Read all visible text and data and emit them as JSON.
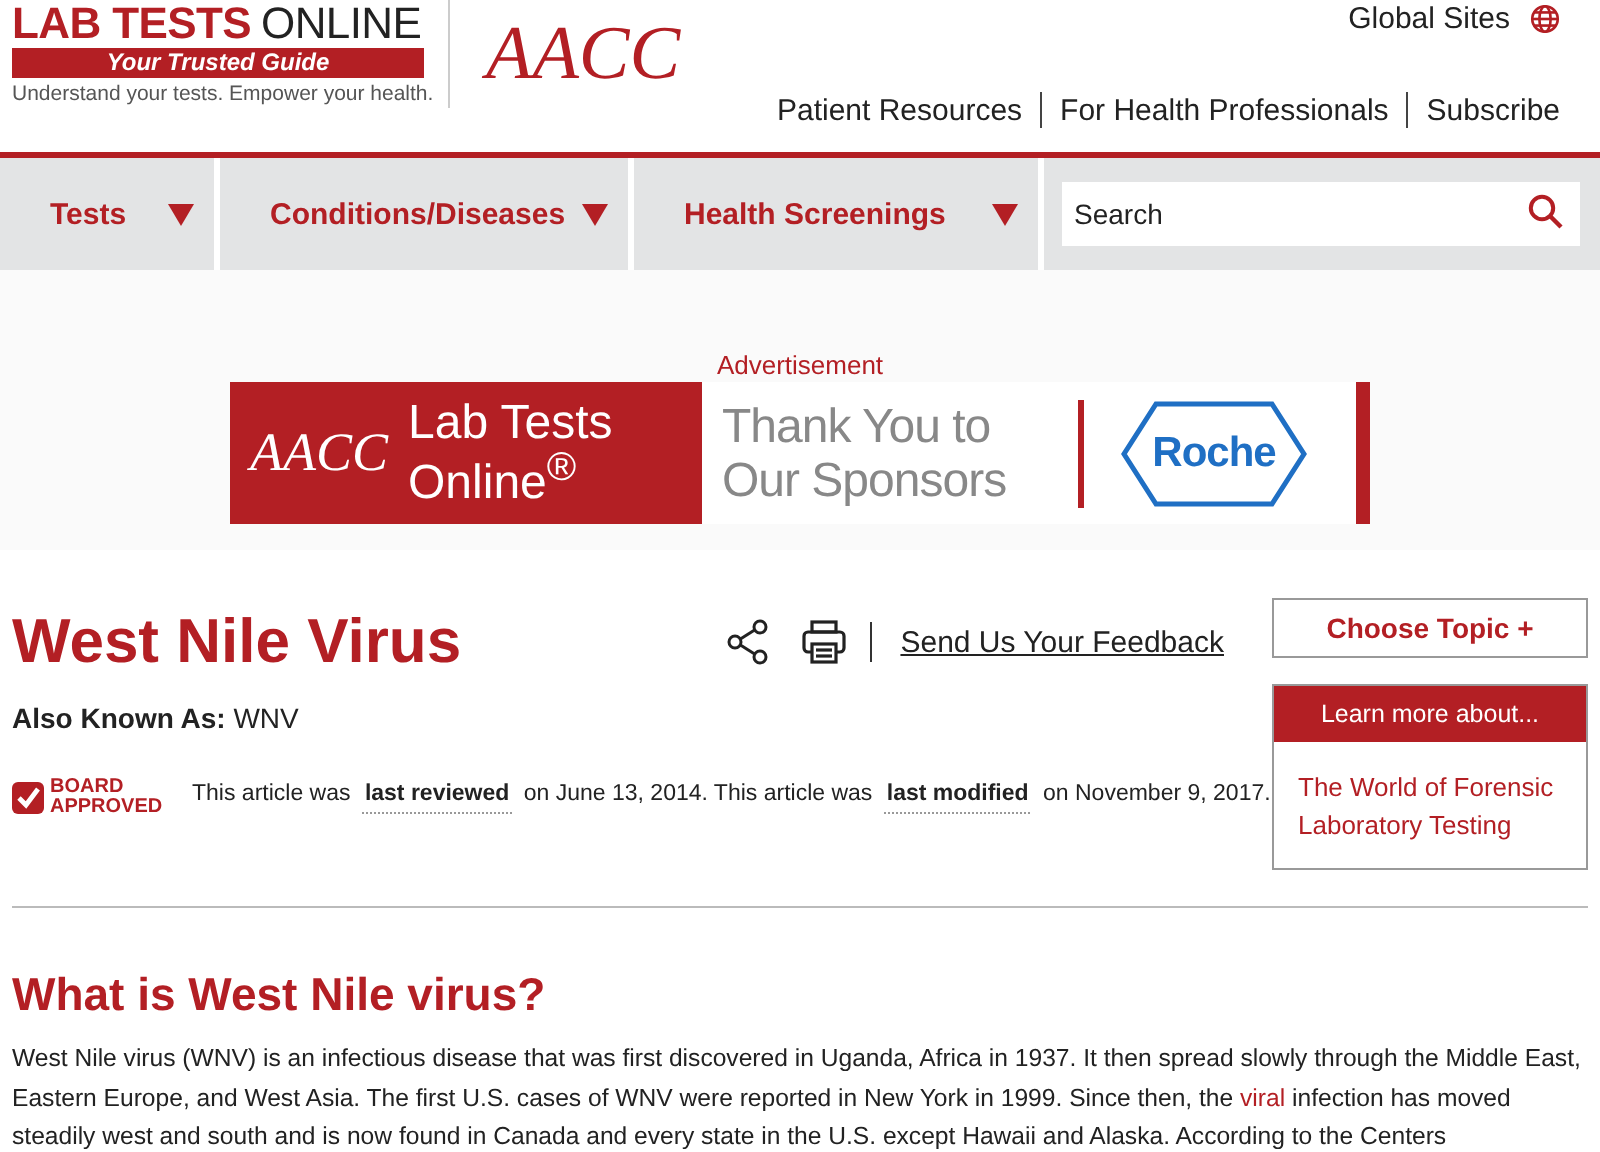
{
  "logo": {
    "brand_red": "LAB TESTS",
    "brand_dark": "ONLINE",
    "slogan": "Your Trusted Guide",
    "tagline": "Understand your tests. Empower your health.",
    "partner": "AACC"
  },
  "global_sites": "Global Sites",
  "top_links": [
    "Patient Resources",
    "For Health Professionals",
    "Subscribe"
  ],
  "nav": [
    {
      "label": "Tests"
    },
    {
      "label": "Conditions/Diseases"
    },
    {
      "label": "Health Screenings"
    }
  ],
  "search": {
    "placeholder": "Search"
  },
  "ad": {
    "label": "Advertisement",
    "aacc": "AACC",
    "brand": "Lab Tests Online$^{®}$",
    "thanks": "Thank You to Our Sponsors",
    "sponsor": "Roche"
  },
  "title": "West Nile Virus",
  "feedback": "Send Us Your Feedback",
  "aka": {
    "label": "Also Known As:",
    "value": "WNV"
  },
  "badge": {
    "line1": "BOARD",
    "line2": "APPROVED"
  },
  "review": "This article was **last reviewed** on June 13, 2014. This article was **last modified** on November 9, 2017.",
  "sidebar": {
    "choose": "Choose Topic +",
    "learn": "Learn more about...",
    "links": [
      "The World of Forensic Laboratory Testing"
    ]
  },
  "heading": "What is West Nile virus?",
  "paragraph": {
    "before": "West Nile virus (WNV) is an infectious disease that was first discovered in Uganda, Africa in 1937. It then spread slowly through the Middle East, Eastern Europe, and West Asia. The first U.S. cases of WNV were reported in New York in 1999. Since then, the",
    "link": "viral",
    "after": "infection has moved steadily west and south and is now found in Canada and every state in the U.S. except Hawaii and Alaska.  According to the Centers"
  }
}
